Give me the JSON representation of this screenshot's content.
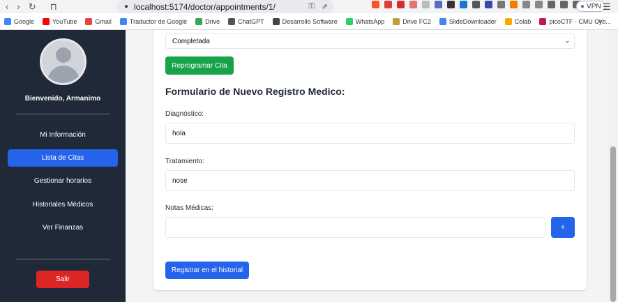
{
  "browser": {
    "url": "localhost:5174/doctor/appointments/1/",
    "vpn_label": "VPN",
    "bookmarks": [
      "Google",
      "YouTube",
      "Gmail",
      "Traductor de Google",
      "Drive",
      "ChatGPT",
      "Desarrollo Software",
      "WhatsApp",
      "Drive FC2",
      "SlideDownloader",
      "Colab",
      "picoCTF - CMU Cyb..."
    ],
    "bookmark_colors": [
      "#4285f4",
      "#ff0000",
      "#ea4335",
      "#4285f4",
      "#34a853",
      "#555555",
      "#444444",
      "#25d366",
      "#c59a3a",
      "#4285f4",
      "#f9ab00",
      "#c2185b"
    ],
    "more_label": "»"
  },
  "sidebar": {
    "welcome": "Bienvenido, Armanimo",
    "items": [
      {
        "label": "Mi Información"
      },
      {
        "label": "Lista de Citas"
      },
      {
        "label": "Gestionar horarios"
      },
      {
        "label": "Historiales Médicos"
      },
      {
        "label": "Ver Finanzas"
      }
    ],
    "active_index": 1,
    "logout_label": "Salir"
  },
  "main": {
    "status_select": "Completada",
    "reschedule_label": "Reprogramar Cita",
    "form_title": "Formulario de Nuevo Registro Medico:",
    "diagnosis_label": "Diagnóstico:",
    "diagnosis_value": "hola",
    "treatment_label": "Tratamiento:",
    "treatment_value": "nose",
    "notes_label": "Notas Médicas:",
    "notes_value": "",
    "add_note_label": "+",
    "submit_label": "Registrar en el historial"
  },
  "colors": {
    "sidebar_bg": "#1f2937",
    "active_item": "#2563eb",
    "logout": "#dc2626",
    "reschedule": "#16a34a",
    "primary": "#2563eb"
  }
}
